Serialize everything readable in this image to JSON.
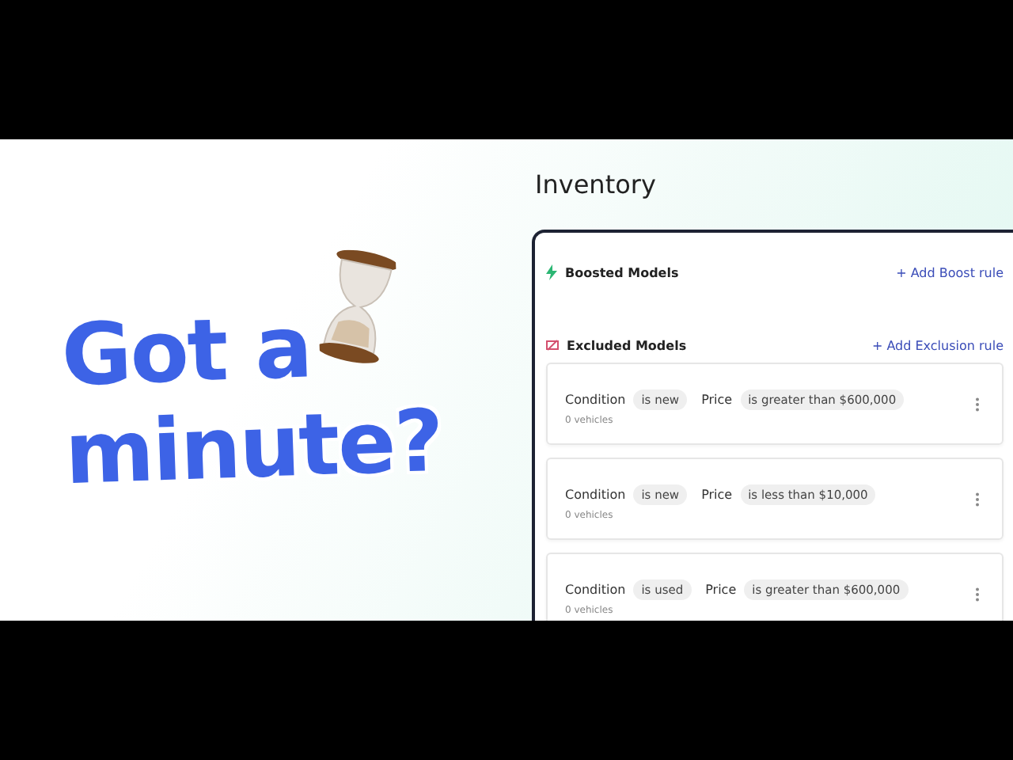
{
  "headline": {
    "lines": [
      "Got a",
      "minute?"
    ]
  },
  "inventory": {
    "title": "Inventory",
    "sections": [
      {
        "kind": "boosted",
        "title": "Boosted Models",
        "action": "+ Add Boost rule"
      },
      {
        "kind": "excluded",
        "title": "Excluded Models",
        "action": "+ Add Exclusion rule"
      }
    ],
    "rules": [
      {
        "condition_label": "Condition",
        "condition": "is new",
        "price_label": "Price",
        "price": "is greater than $600,000",
        "count": "0 vehicles"
      },
      {
        "condition_label": "Condition",
        "condition": "is new",
        "price_label": "Price",
        "price": "is less than $10,000",
        "count": "0 vehicles"
      },
      {
        "condition_label": "Condition",
        "condition": "is used",
        "price_label": "Price",
        "price": "is greater than $600,000",
        "count": "0 vehicles"
      }
    ]
  }
}
